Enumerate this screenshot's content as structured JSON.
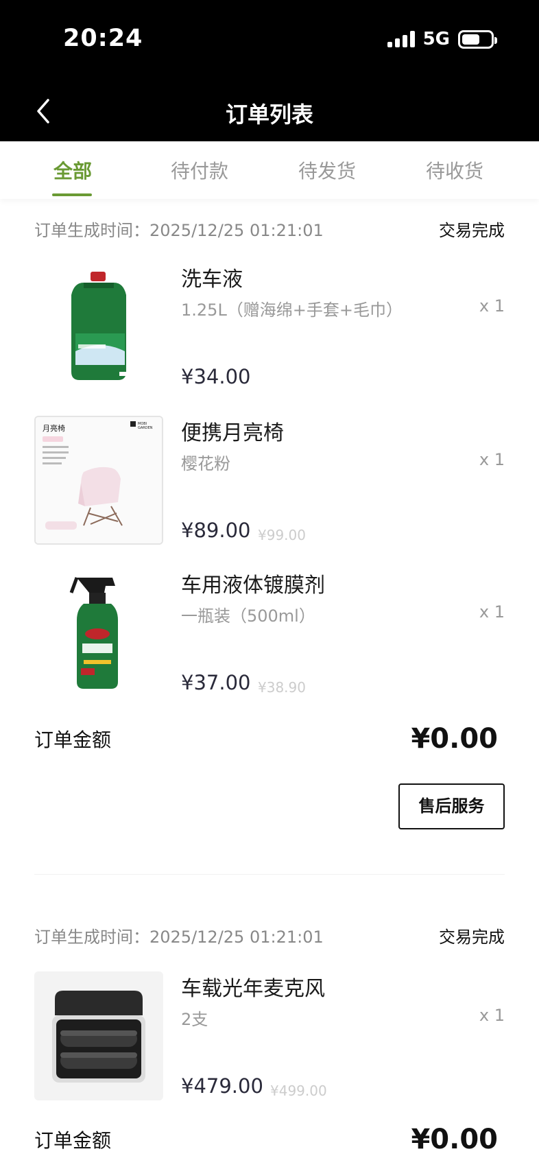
{
  "status_bar": {
    "time": "20:24",
    "network": "5G",
    "battery_level": 0.62
  },
  "nav": {
    "title": "订单列表",
    "back_icon": "chevron-left-icon"
  },
  "tabs": [
    {
      "label": "全部",
      "active": true
    },
    {
      "label": "待付款",
      "active": false
    },
    {
      "label": "待发货",
      "active": false
    },
    {
      "label": "待收货",
      "active": false
    }
  ],
  "orders": [
    {
      "time_label": "订单生成时间：2025/12/25 01:21:01",
      "status": "交易完成",
      "items": [
        {
          "name": "洗车液",
          "spec": "1.25L（赠海绵+手套+毛巾）",
          "qty": "x 1",
          "price": "¥34.00",
          "original_price": "",
          "image": "car-wash-bottle"
        },
        {
          "name": "便携月亮椅",
          "spec": "樱花粉",
          "qty": "x 1",
          "price": "¥89.00",
          "original_price": "¥99.00",
          "image": "moon-chair",
          "image_text": {
            "title": "月亮椅",
            "brand_top": "MOBI",
            "brand_bottom": "GARDEN"
          }
        },
        {
          "name": "车用液体镀膜剂",
          "spec": "一瓶装（500ml）",
          "qty": "x 1",
          "price": "¥37.00",
          "original_price": "¥38.90",
          "image": "coating-spray-bottle"
        }
      ],
      "total_label": "订单金额",
      "total_value": "¥0.00",
      "action_label": "售后服务"
    },
    {
      "time_label": "订单生成时间：2025/12/25 01:21:01",
      "status": "交易完成",
      "items": [
        {
          "name": "车载光年麦克风",
          "spec": "2支",
          "qty": "x 1",
          "price": "¥479.00",
          "original_price": "¥499.00",
          "image": "microphone-case"
        }
      ],
      "total_label": "订单金额",
      "total_value": "¥0.00"
    }
  ],
  "colors": {
    "accent": "#6a9a34",
    "header_bg": "#000000"
  }
}
